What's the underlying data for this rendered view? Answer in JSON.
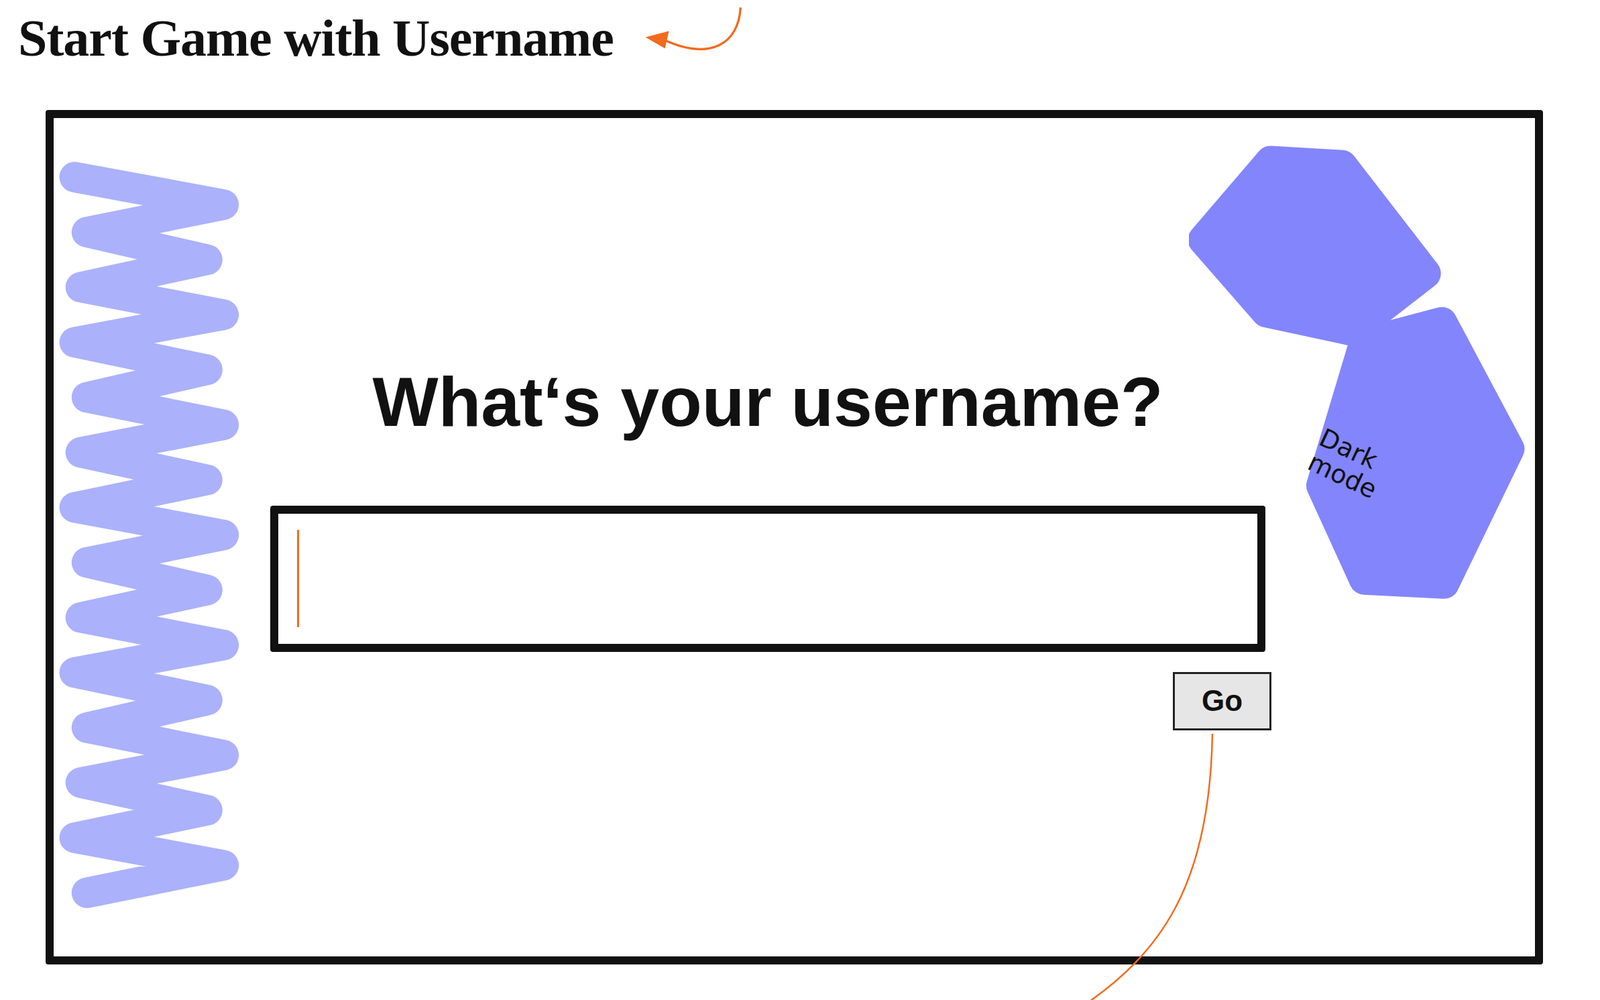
{
  "page": {
    "title": "Start Game with Username"
  },
  "frame": {
    "heading": "What‘s your username?",
    "input": {
      "value": "",
      "focused": true
    },
    "button": "Go",
    "dark_mode": {
      "label": "Dark mode"
    }
  }
}
